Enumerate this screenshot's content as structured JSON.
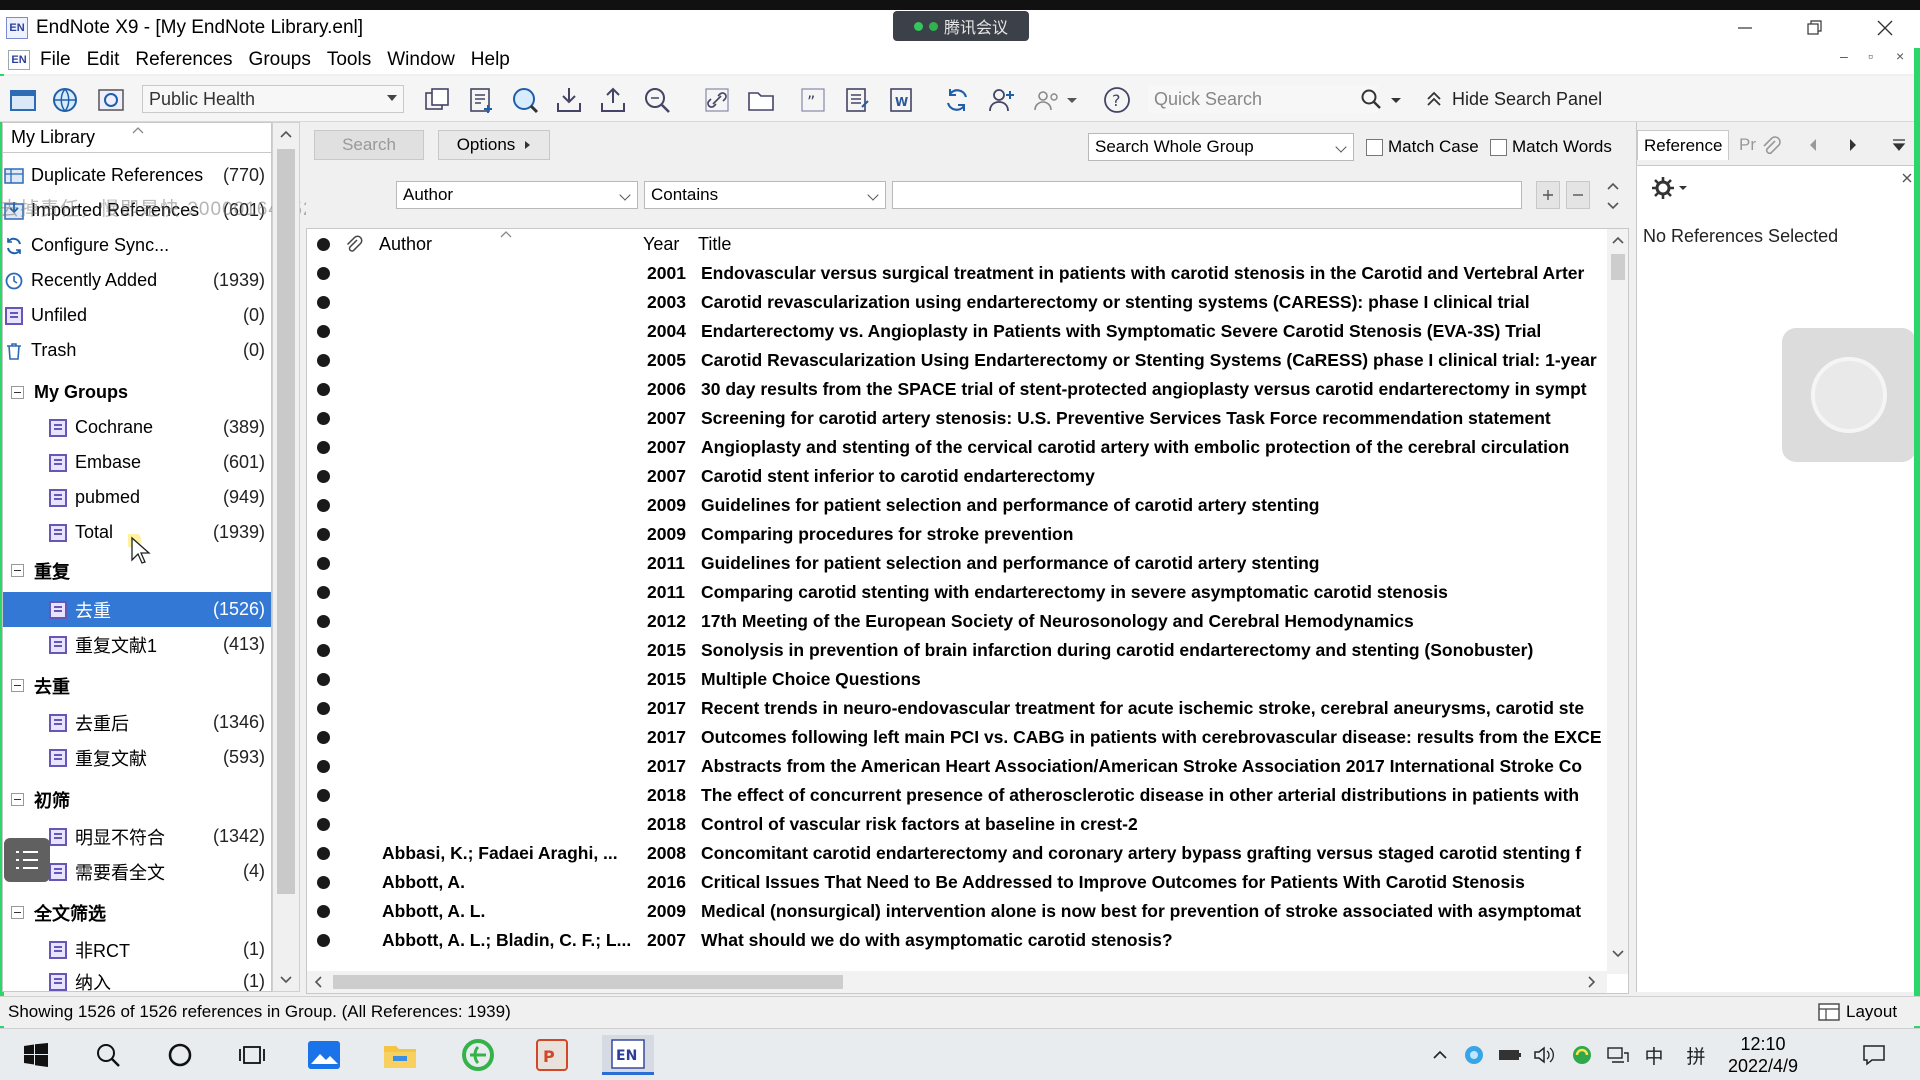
{
  "window": {
    "title": "EndNote X9 - [My EndNote Library.enl]",
    "app_icon": "EN",
    "meeting_label": "腾讯会议"
  },
  "menu": {
    "items": [
      "File",
      "Edit",
      "References",
      "Groups",
      "Tools",
      "Window",
      "Help"
    ]
  },
  "toolbar": {
    "group_select": "Public Health",
    "quick_search_placeholder": "Quick Search",
    "hide_search_panel": "Hide Search Panel"
  },
  "sidebar": {
    "header": "My Library",
    "watermark": "去掉责任，慢即是快-20000164552948871",
    "items": [
      {
        "label": "Duplicate References",
        "count": "(770)",
        "icon": "duplicate-icon"
      },
      {
        "label": "Imported References",
        "count": "(601)",
        "icon": "import-icon"
      },
      {
        "label": "Configure Sync...",
        "count": "",
        "icon": "sync-icon"
      },
      {
        "label": "Recently Added",
        "count": "(1939)",
        "icon": "recent-icon"
      },
      {
        "label": "Unfiled",
        "count": "(0)",
        "icon": "unfiled-icon"
      },
      {
        "label": "Trash",
        "count": "(0)",
        "icon": "trash-icon"
      }
    ],
    "groups": [
      {
        "name": "My Groups",
        "items": [
          {
            "label": "Cochrane",
            "count": "(389)"
          },
          {
            "label": "Embase",
            "count": "(601)"
          },
          {
            "label": "pubmed",
            "count": "(949)"
          },
          {
            "label": "Total",
            "count": "(1939)"
          }
        ]
      },
      {
        "name": "重复",
        "items": [
          {
            "label": "去重",
            "count": "(1526)",
            "selected": true
          },
          {
            "label": "重复文献1",
            "count": "(413)"
          }
        ]
      },
      {
        "name": "去重",
        "items": [
          {
            "label": "去重后",
            "count": "(1346)"
          },
          {
            "label": "重复文献",
            "count": "(593)"
          }
        ]
      },
      {
        "name": "初筛",
        "items": [
          {
            "label": "明显不符合",
            "count": "(1342)"
          },
          {
            "label": "需要看全文",
            "count": "(4)"
          }
        ]
      },
      {
        "name": "全文筛选",
        "items": [
          {
            "label": "非RCT",
            "count": "(1)"
          },
          {
            "label": "纳入",
            "count": "(1)"
          }
        ]
      }
    ]
  },
  "search_panel": {
    "search_button": "Search",
    "options_button": "Options",
    "scope": "Search Whole Group",
    "match_case": "Match Case",
    "match_words": "Match Words",
    "field": "Author",
    "operator": "Contains",
    "value": ""
  },
  "reference_list": {
    "columns": {
      "author": "Author",
      "year": "Year",
      "title": "Title"
    },
    "rows": [
      {
        "author": "",
        "year": "2001",
        "title": "Endovascular versus surgical treatment in patients with carotid stenosis in the Carotid and Vertebral Arter"
      },
      {
        "author": "",
        "year": "2003",
        "title": "Carotid revascularization using endarterectomy or stenting systems (CARESS): phase I clinical trial"
      },
      {
        "author": "",
        "year": "2004",
        "title": "Endarterectomy vs. Angioplasty in Patients with Symptomatic Severe Carotid Stenosis (EVA-3S) Trial"
      },
      {
        "author": "",
        "year": "2005",
        "title": "Carotid Revascularization Using Endarterectomy or Stenting Systems (CaRESS) phase I clinical trial: 1-year"
      },
      {
        "author": "",
        "year": "2006",
        "title": "30 day results from the SPACE trial of stent-protected angioplasty versus carotid endarterectomy in sympt"
      },
      {
        "author": "",
        "year": "2007",
        "title": "Screening for carotid artery stenosis: U.S. Preventive Services Task Force recommendation statement"
      },
      {
        "author": "",
        "year": "2007",
        "title": "Angioplasty and stenting of the cervical carotid artery with embolic protection of the cerebral circulation"
      },
      {
        "author": "",
        "year": "2007",
        "title": "Carotid stent inferior to carotid endarterectomy"
      },
      {
        "author": "",
        "year": "2009",
        "title": "Guidelines for patient selection and performance of carotid artery stenting"
      },
      {
        "author": "",
        "year": "2009",
        "title": "Comparing procedures for stroke prevention"
      },
      {
        "author": "",
        "year": "2011",
        "title": "Guidelines for patient selection and performance of carotid artery stenting"
      },
      {
        "author": "",
        "year": "2011",
        "title": "Comparing carotid stenting with endarterectomy in severe asymptomatic carotid stenosis"
      },
      {
        "author": "",
        "year": "2012",
        "title": "17th Meeting of the European Society of Neurosonology and Cerebral Hemodynamics"
      },
      {
        "author": "",
        "year": "2015",
        "title": "Sonolysis in prevention of brain infarction during carotid endarterectomy and stenting (Sonobuster)"
      },
      {
        "author": "",
        "year": "2015",
        "title": "Multiple Choice Questions"
      },
      {
        "author": "",
        "year": "2017",
        "title": "Recent trends in neuro-endovascular treatment for acute ischemic stroke, cerebral aneurysms, carotid ste"
      },
      {
        "author": "",
        "year": "2017",
        "title": "Outcomes following left main PCI vs. CABG in patients with cerebrovascular disease: results from the EXCE"
      },
      {
        "author": "",
        "year": "2017",
        "title": "Abstracts from the American Heart Association/American Stroke Association 2017 International Stroke Co"
      },
      {
        "author": "",
        "year": "2018",
        "title": "The effect of concurrent presence of atherosclerotic disease in other arterial distributions in patients with"
      },
      {
        "author": "",
        "year": "2018",
        "title": "Control of vascular risk factors at baseline in crest-2"
      },
      {
        "author": "Abbasi, K.; Fadaei Araghi, ...",
        "year": "2008",
        "title": "Concomitant carotid endarterectomy and coronary artery bypass grafting versus staged carotid stenting f"
      },
      {
        "author": "Abbott, A.",
        "year": "2016",
        "title": "Critical Issues That Need to Be Addressed to Improve Outcomes for Patients With Carotid Stenosis"
      },
      {
        "author": "Abbott, A. L.",
        "year": "2009",
        "title": "Medical (nonsurgical) intervention alone is now best for prevention of stroke associated with asymptomat"
      },
      {
        "author": "Abbott, A. L.; Bladin, C. F.; L...",
        "year": "2007",
        "title": "What should we do with asymptomatic carotid stenosis?"
      }
    ]
  },
  "right_panel": {
    "tab_reference": "Reference",
    "tab_preview": "Pr",
    "empty_message": "No References Selected"
  },
  "status": {
    "text": "Showing 1526 of 1526 references in Group. (All References: 1939)",
    "layout_button": "Layout"
  },
  "taskbar": {
    "time": "12:10",
    "date": "2022/4/9",
    "ime_1": "中",
    "ime_2": "拼"
  }
}
